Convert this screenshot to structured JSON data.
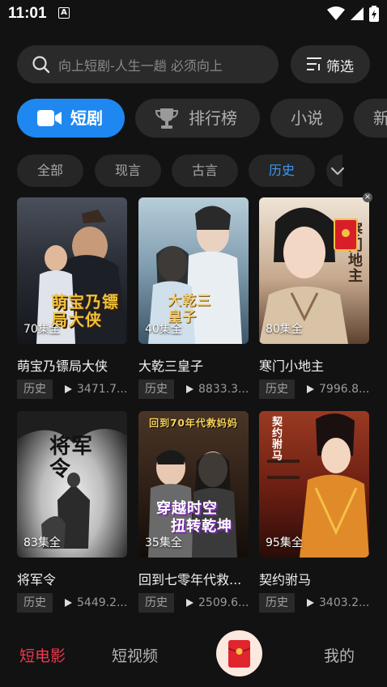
{
  "status_bar": {
    "time": "11:01",
    "notification_glyph": "A"
  },
  "search": {
    "placeholder": "向上短剧-人生一趟 必须向上",
    "filter_label": "筛选"
  },
  "categories": [
    {
      "label": "短剧",
      "active": true,
      "icon": "video-camera-icon"
    },
    {
      "label": "排行榜",
      "active": false,
      "icon": "trophy-icon"
    },
    {
      "label": "小说",
      "active": false
    },
    {
      "label": "新",
      "active": false
    }
  ],
  "genres": [
    {
      "label": "全部",
      "active": false
    },
    {
      "label": "现言",
      "active": false
    },
    {
      "label": "古言",
      "active": false
    },
    {
      "label": "历史",
      "active": true
    }
  ],
  "dramas": [
    {
      "title": "萌宝乃镖局大侠",
      "episodes": "70集全",
      "tag": "历史",
      "views": "3471.7...",
      "poster_text": "萌宝乃镖局大侠",
      "colors": [
        "#3a3f4a",
        "#1c2028"
      ]
    },
    {
      "title": "大乾三皇子",
      "episodes": "40集全",
      "tag": "历史",
      "views": "8833.3...",
      "poster_text": "大乾三皇子",
      "colors": [
        "#8ea7b8",
        "#4e6677"
      ]
    },
    {
      "title": "寒门小地主",
      "episodes": "80集全",
      "tag": "历史",
      "views": "7996.8...",
      "poster_text": "寒门地主",
      "colors": [
        "#e9dccf",
        "#7a5a44"
      ]
    },
    {
      "title": "将军令",
      "episodes": "83集全",
      "tag": "历史",
      "views": "5449.2...",
      "poster_text": "将军令",
      "colors": [
        "#e4e4e4",
        "#2b2b2b"
      ]
    },
    {
      "title": "回到七零年代救...",
      "episodes": "35集全",
      "tag": "历史",
      "views": "2509.6...",
      "poster_text_top": "回到70年代救妈妈",
      "poster_text_mid": "穿越时空",
      "poster_text_bot": "扭转乾坤",
      "colors": [
        "#3b2a1e",
        "#1a120c"
      ]
    },
    {
      "title": "契约驸马",
      "episodes": "95集全",
      "tag": "历史",
      "views": "3403.2...",
      "poster_text": "契约驸马",
      "colors": [
        "#8a2a1e",
        "#3a100c"
      ]
    }
  ],
  "tabbar": {
    "items": [
      {
        "label": "短电影",
        "active": true
      },
      {
        "label": "短视频",
        "active": false
      },
      {
        "label": "我的",
        "active": false
      }
    ],
    "center_icon": "red-envelope-icon"
  },
  "accent_colors": {
    "blue": "#1e88f0",
    "red": "#f2374e"
  }
}
